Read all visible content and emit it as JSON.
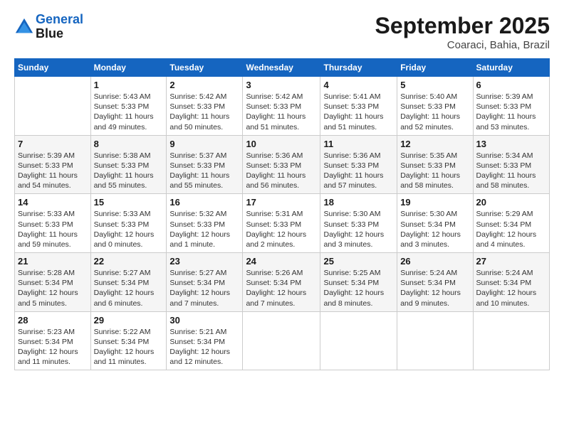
{
  "header": {
    "logo_line1": "General",
    "logo_line2": "Blue",
    "month_title": "September 2025",
    "location": "Coaraci, Bahia, Brazil"
  },
  "days_of_week": [
    "Sunday",
    "Monday",
    "Tuesday",
    "Wednesday",
    "Thursday",
    "Friday",
    "Saturday"
  ],
  "weeks": [
    [
      {
        "day": "",
        "detail": ""
      },
      {
        "day": "1",
        "detail": "Sunrise: 5:43 AM\nSunset: 5:33 PM\nDaylight: 11 hours\nand 49 minutes."
      },
      {
        "day": "2",
        "detail": "Sunrise: 5:42 AM\nSunset: 5:33 PM\nDaylight: 11 hours\nand 50 minutes."
      },
      {
        "day": "3",
        "detail": "Sunrise: 5:42 AM\nSunset: 5:33 PM\nDaylight: 11 hours\nand 51 minutes."
      },
      {
        "day": "4",
        "detail": "Sunrise: 5:41 AM\nSunset: 5:33 PM\nDaylight: 11 hours\nand 51 minutes."
      },
      {
        "day": "5",
        "detail": "Sunrise: 5:40 AM\nSunset: 5:33 PM\nDaylight: 11 hours\nand 52 minutes."
      },
      {
        "day": "6",
        "detail": "Sunrise: 5:39 AM\nSunset: 5:33 PM\nDaylight: 11 hours\nand 53 minutes."
      }
    ],
    [
      {
        "day": "7",
        "detail": "Sunrise: 5:39 AM\nSunset: 5:33 PM\nDaylight: 11 hours\nand 54 minutes."
      },
      {
        "day": "8",
        "detail": "Sunrise: 5:38 AM\nSunset: 5:33 PM\nDaylight: 11 hours\nand 55 minutes."
      },
      {
        "day": "9",
        "detail": "Sunrise: 5:37 AM\nSunset: 5:33 PM\nDaylight: 11 hours\nand 55 minutes."
      },
      {
        "day": "10",
        "detail": "Sunrise: 5:36 AM\nSunset: 5:33 PM\nDaylight: 11 hours\nand 56 minutes."
      },
      {
        "day": "11",
        "detail": "Sunrise: 5:36 AM\nSunset: 5:33 PM\nDaylight: 11 hours\nand 57 minutes."
      },
      {
        "day": "12",
        "detail": "Sunrise: 5:35 AM\nSunset: 5:33 PM\nDaylight: 11 hours\nand 58 minutes."
      },
      {
        "day": "13",
        "detail": "Sunrise: 5:34 AM\nSunset: 5:33 PM\nDaylight: 11 hours\nand 58 minutes."
      }
    ],
    [
      {
        "day": "14",
        "detail": "Sunrise: 5:33 AM\nSunset: 5:33 PM\nDaylight: 11 hours\nand 59 minutes."
      },
      {
        "day": "15",
        "detail": "Sunrise: 5:33 AM\nSunset: 5:33 PM\nDaylight: 12 hours\nand 0 minutes."
      },
      {
        "day": "16",
        "detail": "Sunrise: 5:32 AM\nSunset: 5:33 PM\nDaylight: 12 hours\nand 1 minute."
      },
      {
        "day": "17",
        "detail": "Sunrise: 5:31 AM\nSunset: 5:33 PM\nDaylight: 12 hours\nand 2 minutes."
      },
      {
        "day": "18",
        "detail": "Sunrise: 5:30 AM\nSunset: 5:33 PM\nDaylight: 12 hours\nand 3 minutes."
      },
      {
        "day": "19",
        "detail": "Sunrise: 5:30 AM\nSunset: 5:34 PM\nDaylight: 12 hours\nand 3 minutes."
      },
      {
        "day": "20",
        "detail": "Sunrise: 5:29 AM\nSunset: 5:34 PM\nDaylight: 12 hours\nand 4 minutes."
      }
    ],
    [
      {
        "day": "21",
        "detail": "Sunrise: 5:28 AM\nSunset: 5:34 PM\nDaylight: 12 hours\nand 5 minutes."
      },
      {
        "day": "22",
        "detail": "Sunrise: 5:27 AM\nSunset: 5:34 PM\nDaylight: 12 hours\nand 6 minutes."
      },
      {
        "day": "23",
        "detail": "Sunrise: 5:27 AM\nSunset: 5:34 PM\nDaylight: 12 hours\nand 7 minutes."
      },
      {
        "day": "24",
        "detail": "Sunrise: 5:26 AM\nSunset: 5:34 PM\nDaylight: 12 hours\nand 7 minutes."
      },
      {
        "day": "25",
        "detail": "Sunrise: 5:25 AM\nSunset: 5:34 PM\nDaylight: 12 hours\nand 8 minutes."
      },
      {
        "day": "26",
        "detail": "Sunrise: 5:24 AM\nSunset: 5:34 PM\nDaylight: 12 hours\nand 9 minutes."
      },
      {
        "day": "27",
        "detail": "Sunrise: 5:24 AM\nSunset: 5:34 PM\nDaylight: 12 hours\nand 10 minutes."
      }
    ],
    [
      {
        "day": "28",
        "detail": "Sunrise: 5:23 AM\nSunset: 5:34 PM\nDaylight: 12 hours\nand 11 minutes."
      },
      {
        "day": "29",
        "detail": "Sunrise: 5:22 AM\nSunset: 5:34 PM\nDaylight: 12 hours\nand 11 minutes."
      },
      {
        "day": "30",
        "detail": "Sunrise: 5:21 AM\nSunset: 5:34 PM\nDaylight: 12 hours\nand 12 minutes."
      },
      {
        "day": "",
        "detail": ""
      },
      {
        "day": "",
        "detail": ""
      },
      {
        "day": "",
        "detail": ""
      },
      {
        "day": "",
        "detail": ""
      }
    ]
  ]
}
